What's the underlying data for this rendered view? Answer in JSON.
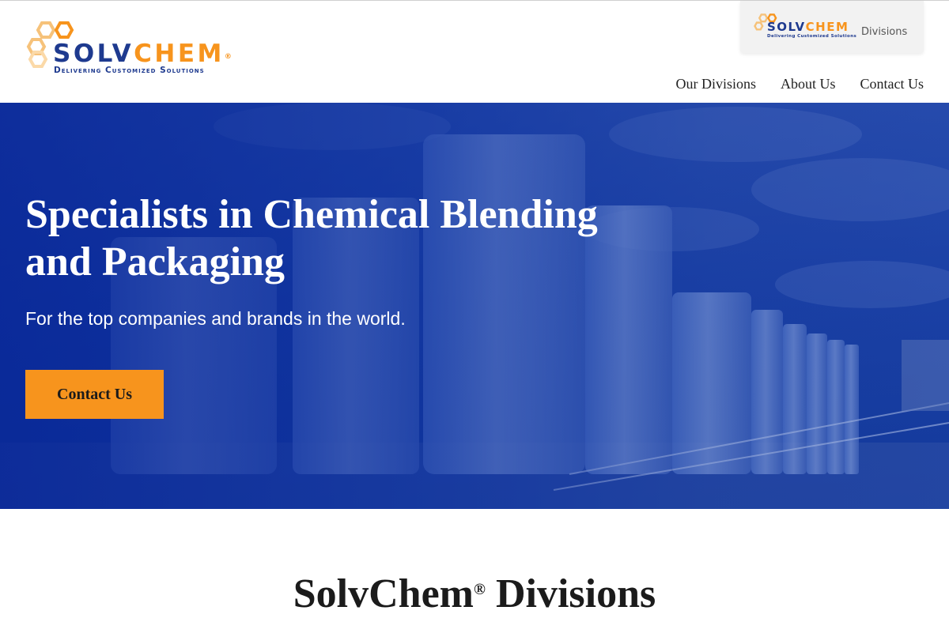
{
  "header": {
    "logo": {
      "word_part1": "SOLV",
      "word_part2": "CHEM",
      "registered": "®",
      "tagline": "Delivering Customized Solutions"
    },
    "divisions_tab": {
      "logo_word_part1": "SOLV",
      "logo_word_part2": "CHEM",
      "logo_tagline": "Delivering Customized Solutions",
      "label": "Divisions"
    },
    "nav": [
      {
        "label": "Our Divisions"
      },
      {
        "label": "About Us"
      },
      {
        "label": "Contact Us"
      }
    ]
  },
  "hero": {
    "title": "Specialists in Chemical Blending and Packaging",
    "subtitle": "For the top companies and brands in the world.",
    "cta_label": "Contact Us"
  },
  "section": {
    "title_part1": "SolvChem",
    "registered": "®",
    "title_part2": " Divisions"
  },
  "colors": {
    "brand_blue": "#1e3a8f",
    "brand_orange": "#f7941d",
    "hero_blue": "#133a9c"
  }
}
